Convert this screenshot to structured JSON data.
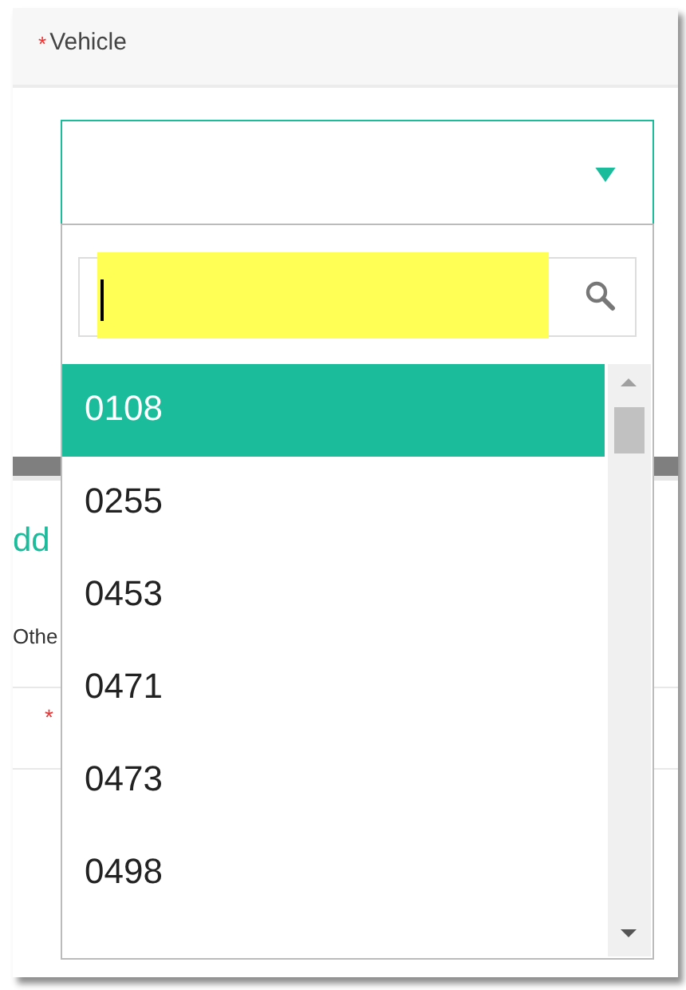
{
  "field": {
    "label": "Vehicle",
    "required_mark": "*",
    "open": true
  },
  "dropdown": {
    "search": {
      "highlighted": true,
      "focused": true
    },
    "options": [
      {
        "label": "0108",
        "selected": true
      },
      {
        "label": "0255",
        "selected": false
      },
      {
        "label": "0453",
        "selected": false
      },
      {
        "label": "0471",
        "selected": false
      },
      {
        "label": "0473",
        "selected": false
      },
      {
        "label": "0498",
        "selected": false
      }
    ]
  },
  "background": {
    "link": "dd",
    "text": "Othe",
    "row_required_mark": "*"
  }
}
